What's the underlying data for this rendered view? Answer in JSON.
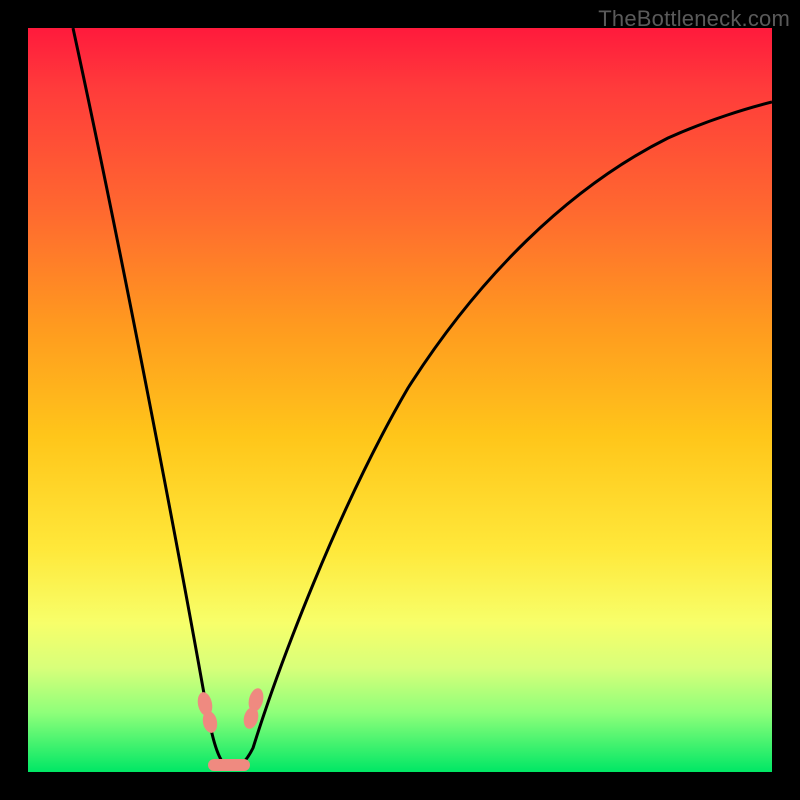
{
  "watermark": "TheBottleneck.com",
  "chart_data": {
    "type": "line",
    "title": "",
    "xlabel": "",
    "ylabel": "",
    "xlim": [
      0,
      100
    ],
    "ylim": [
      0,
      100
    ],
    "grid": false,
    "series": [
      {
        "name": "bottleneck-curve",
        "x": [
          6,
          10,
          15,
          18,
          20,
          22,
          23.5,
          25,
          27,
          28.5,
          30,
          35,
          40,
          45,
          50,
          55,
          60,
          65,
          70,
          75,
          80,
          85,
          90,
          95,
          100
        ],
        "y": [
          100,
          83,
          62,
          48,
          38,
          25,
          12,
          2,
          0,
          2,
          10,
          28,
          40,
          49,
          56,
          62,
          67,
          71,
          74.5,
          77.5,
          80,
          82,
          83.5,
          85,
          86
        ]
      }
    ],
    "markers": [
      {
        "name": "left-transition-marker",
        "x": 23.5,
        "y": 9
      },
      {
        "name": "right-transition-marker",
        "x": 30,
        "y": 9
      },
      {
        "name": "optimal-range-marker",
        "x_range": [
          25,
          29
        ],
        "y": 1
      }
    ],
    "background_gradient": {
      "top_color": "#ff1a3c",
      "mid_color": "#ffe83a",
      "bottom_color": "#00e765"
    }
  }
}
